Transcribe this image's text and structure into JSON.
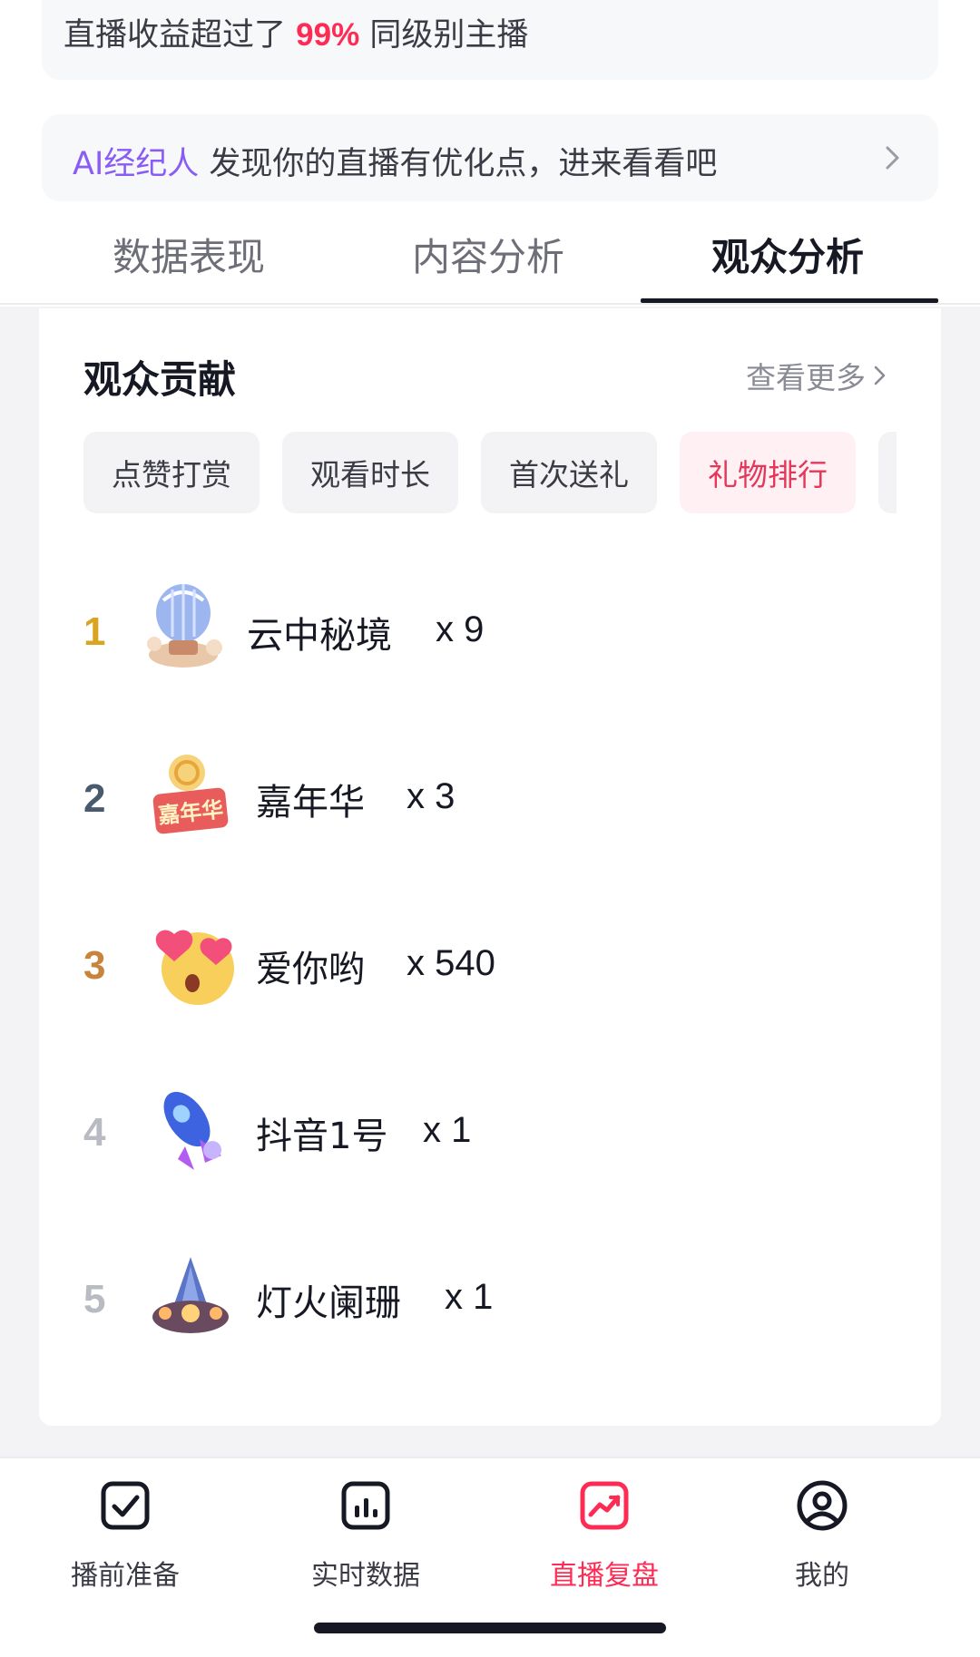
{
  "income_card": {
    "prefix": "直播收益超过了",
    "highlight": "99%",
    "suffix": "同级别主播"
  },
  "ai_banner": {
    "brand": "AI经纪人",
    "text": "发现你的直播有优化点，进来看看吧"
  },
  "tabs": [
    {
      "label": "数据表现",
      "active": false
    },
    {
      "label": "内容分析",
      "active": false
    },
    {
      "label": "观众分析",
      "active": true
    }
  ],
  "section": {
    "title": "观众贡献",
    "see_more": "查看更多"
  },
  "chips": [
    {
      "label": "点赞打赏",
      "active": false
    },
    {
      "label": "观看时长",
      "active": false
    },
    {
      "label": "首次送礼",
      "active": false
    },
    {
      "label": "礼物排行",
      "active": true
    }
  ],
  "gift_ranking": [
    {
      "rank": "1",
      "name": "云中秘境",
      "count": "x 9",
      "icon": "hot-air-balloon-gift-icon",
      "rank_color": "#d9a520"
    },
    {
      "rank": "2",
      "name": "嘉年华",
      "count": "x 3",
      "icon": "carnival-gift-icon",
      "rank_color": "#4a5a6e"
    },
    {
      "rank": "3",
      "name": "爱你哟",
      "count": "x 540",
      "icon": "heart-eyes-gift-icon",
      "rank_color": "#c8843a"
    },
    {
      "rank": "4",
      "name": "抖音1号",
      "count": "x 1",
      "icon": "rocket-gift-icon",
      "rank_color": "#b9bbc2"
    },
    {
      "rank": "5",
      "name": "灯火阑珊",
      "count": "x 1",
      "icon": "lantern-castle-gift-icon",
      "rank_color": "#b9bbc2"
    }
  ],
  "bottom_nav": [
    {
      "label": "播前准备",
      "icon": "checkbox-icon",
      "active": false
    },
    {
      "label": "实时数据",
      "icon": "bar-chart-icon",
      "active": false
    },
    {
      "label": "直播复盘",
      "icon": "trend-chart-icon",
      "active": true
    },
    {
      "label": "我的",
      "icon": "user-profile-icon",
      "active": false
    }
  ],
  "colors": {
    "accent": "#fe2c55",
    "ai_brand": "#8a5cf6",
    "text_primary": "#161823"
  }
}
